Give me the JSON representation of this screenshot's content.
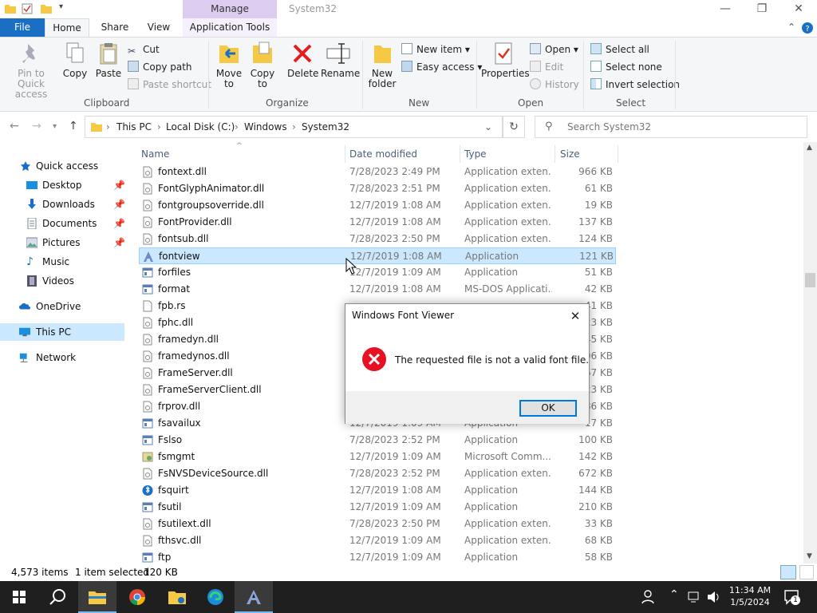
{
  "window": {
    "title": "System32",
    "context_tab": "Manage",
    "minimize": "—",
    "maximize": "❐",
    "close": "✕"
  },
  "tabs": {
    "file": "File",
    "home": "Home",
    "share": "Share",
    "view": "View",
    "app_tools": "Application Tools"
  },
  "ribbon": {
    "clipboard": {
      "label": "Clipboard",
      "pin": "Pin to Quick access",
      "copy": "Copy",
      "paste": "Paste",
      "cut": "Cut",
      "copy_path": "Copy path",
      "paste_shortcut": "Paste shortcut"
    },
    "organize": {
      "label": "Organize",
      "move_to": "Move to",
      "copy_to": "Copy to",
      "delete": "Delete",
      "rename": "Rename"
    },
    "new": {
      "label": "New",
      "new_folder": "New folder",
      "new_item": "New item",
      "easy_access": "Easy access"
    },
    "open": {
      "label": "Open",
      "properties": "Properties",
      "open": "Open",
      "edit": "Edit",
      "history": "History"
    },
    "select": {
      "label": "Select",
      "select_all": "Select all",
      "select_none": "Select none",
      "invert": "Invert selection"
    }
  },
  "address": {
    "crumbs": [
      "This PC",
      "Local Disk (C:)",
      "Windows",
      "System32"
    ],
    "search_placeholder": "Search System32"
  },
  "nav_pane": {
    "quick_access": "Quick access",
    "desktop": "Desktop",
    "downloads": "Downloads",
    "documents": "Documents",
    "pictures": "Pictures",
    "music": "Music",
    "videos": "Videos",
    "onedrive": "OneDrive",
    "this_pc": "This PC",
    "network": "Network"
  },
  "columns": {
    "name": "Name",
    "date": "Date modified",
    "type": "Type",
    "size": "Size"
  },
  "files": [
    {
      "name": "fontext.dll",
      "date": "7/28/2023 2:49 PM",
      "type": "Application exten...",
      "size": "966 KB"
    },
    {
      "name": "FontGlyphAnimator.dll",
      "date": "7/28/2023 2:51 PM",
      "type": "Application exten...",
      "size": "61 KB"
    },
    {
      "name": "fontgroupsoverride.dll",
      "date": "12/7/2019 1:08 AM",
      "type": "Application exten...",
      "size": "19 KB"
    },
    {
      "name": "FontProvider.dll",
      "date": "12/7/2019 1:08 AM",
      "type": "Application exten...",
      "size": "137 KB"
    },
    {
      "name": "fontsub.dll",
      "date": "7/28/2023 2:50 PM",
      "type": "Application exten...",
      "size": "124 KB"
    },
    {
      "name": "fontview",
      "date": "12/7/2019 1:08 AM",
      "type": "Application",
      "size": "121 KB"
    },
    {
      "name": "forfiles",
      "date": "12/7/2019 1:09 AM",
      "type": "Application",
      "size": "51 KB"
    },
    {
      "name": "format",
      "date": "12/7/2019 1:08 AM",
      "type": "MS-DOS Applicati...",
      "size": "42 KB"
    },
    {
      "name": "fpb.rs",
      "date": "",
      "type": "",
      "size": "41 KB"
    },
    {
      "name": "fphc.dll",
      "date": "",
      "type": "",
      "size": "23 KB"
    },
    {
      "name": "framedyn.dll",
      "date": "",
      "type": "",
      "size": "45 KB"
    },
    {
      "name": "framedynos.dll",
      "date": "",
      "type": "",
      "size": "06 KB"
    },
    {
      "name": "FrameServer.dll",
      "date": "",
      "type": "",
      "size": "67 KB"
    },
    {
      "name": "FrameServerClient.dll",
      "date": "",
      "type": "",
      "size": "23 KB"
    },
    {
      "name": "frprov.dll",
      "date": "",
      "type": "",
      "size": "86 KB"
    },
    {
      "name": "fsavailux",
      "date": "12/7/2019 1:09 AM",
      "type": "Application",
      "size": "17 KB"
    },
    {
      "name": "Fslso",
      "date": "7/28/2023 2:52 PM",
      "type": "Application",
      "size": "100 KB"
    },
    {
      "name": "fsmgmt",
      "date": "12/7/2019 1:09 AM",
      "type": "Microsoft Comm...",
      "size": "142 KB"
    },
    {
      "name": "FsNVSDeviceSource.dll",
      "date": "7/28/2023 2:52 PM",
      "type": "Application exten...",
      "size": "672 KB"
    },
    {
      "name": "fsquirt",
      "date": "12/7/2019 1:08 AM",
      "type": "Application",
      "size": "144 KB"
    },
    {
      "name": "fsutil",
      "date": "12/7/2019 1:09 AM",
      "type": "Application",
      "size": "210 KB"
    },
    {
      "name": "fsutilext.dll",
      "date": "7/28/2023 2:50 PM",
      "type": "Application exten...",
      "size": "33 KB"
    },
    {
      "name": "fthsvc.dll",
      "date": "12/7/2019 1:09 AM",
      "type": "Application exten...",
      "size": "68 KB"
    },
    {
      "name": "ftp",
      "date": "12/7/2019 1:09 AM",
      "type": "Application",
      "size": "58 KB"
    }
  ],
  "status": {
    "count": "4,573 items",
    "selected": "1 item selected",
    "size": "120 KB"
  },
  "dialog": {
    "title": "Windows Font Viewer",
    "message": "The requested file  is not a valid font file.",
    "ok": "OK"
  },
  "taskbar": {
    "time": "11:34 AM",
    "date": "1/5/2024",
    "notification_count": "1"
  },
  "colors": {
    "accent": "#0078d7",
    "file_tab": "#1a6fc4",
    "manage_tab": "#dccdf0",
    "selection": "#cce8ff",
    "error": "#e81123"
  }
}
